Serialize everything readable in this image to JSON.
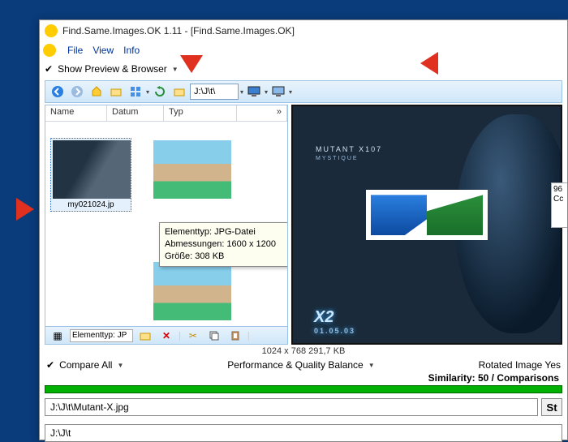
{
  "window": {
    "title": "Find.Same.Images.OK 1.11 - [Find.Same.Images.OK]"
  },
  "menu": {
    "file": "File",
    "view": "View",
    "info": "Info"
  },
  "toggles": {
    "show_preview": "Show Preview & Browser"
  },
  "address": {
    "path": "J:\\J\\t\\"
  },
  "columns": {
    "name": "Name",
    "date": "Datum",
    "type": "Typ",
    "more": "»"
  },
  "thumbs": {
    "selected_name": "my021024.jp"
  },
  "tooltip": {
    "l1": "Elementtyp: JPG-Datei",
    "l2": "Abmessungen: 1600 x 1200",
    "l3": "Größe: 308 KB"
  },
  "status_strip": {
    "element_field": "Elementtyp: JP"
  },
  "preview": {
    "mutant_line": "MUTANT X107",
    "sub_line": "MYSTIQUE",
    "logo": "X2",
    "date": "01.05.03"
  },
  "sidepeek": {
    "l1": "96",
    "l2": "Cc"
  },
  "mid_status": "1024 x 768 291,7 KB",
  "options": {
    "compare_all": "Compare All",
    "perf": "Performance & Quality Balance",
    "rotated": "Rotated Image Yes"
  },
  "similarity": "Similarity: 50 / Comparisons",
  "paths": {
    "image": "J:\\J\\t\\Mutant-X.jpg",
    "start_btn": "St",
    "folder": "J:\\J\\t"
  }
}
